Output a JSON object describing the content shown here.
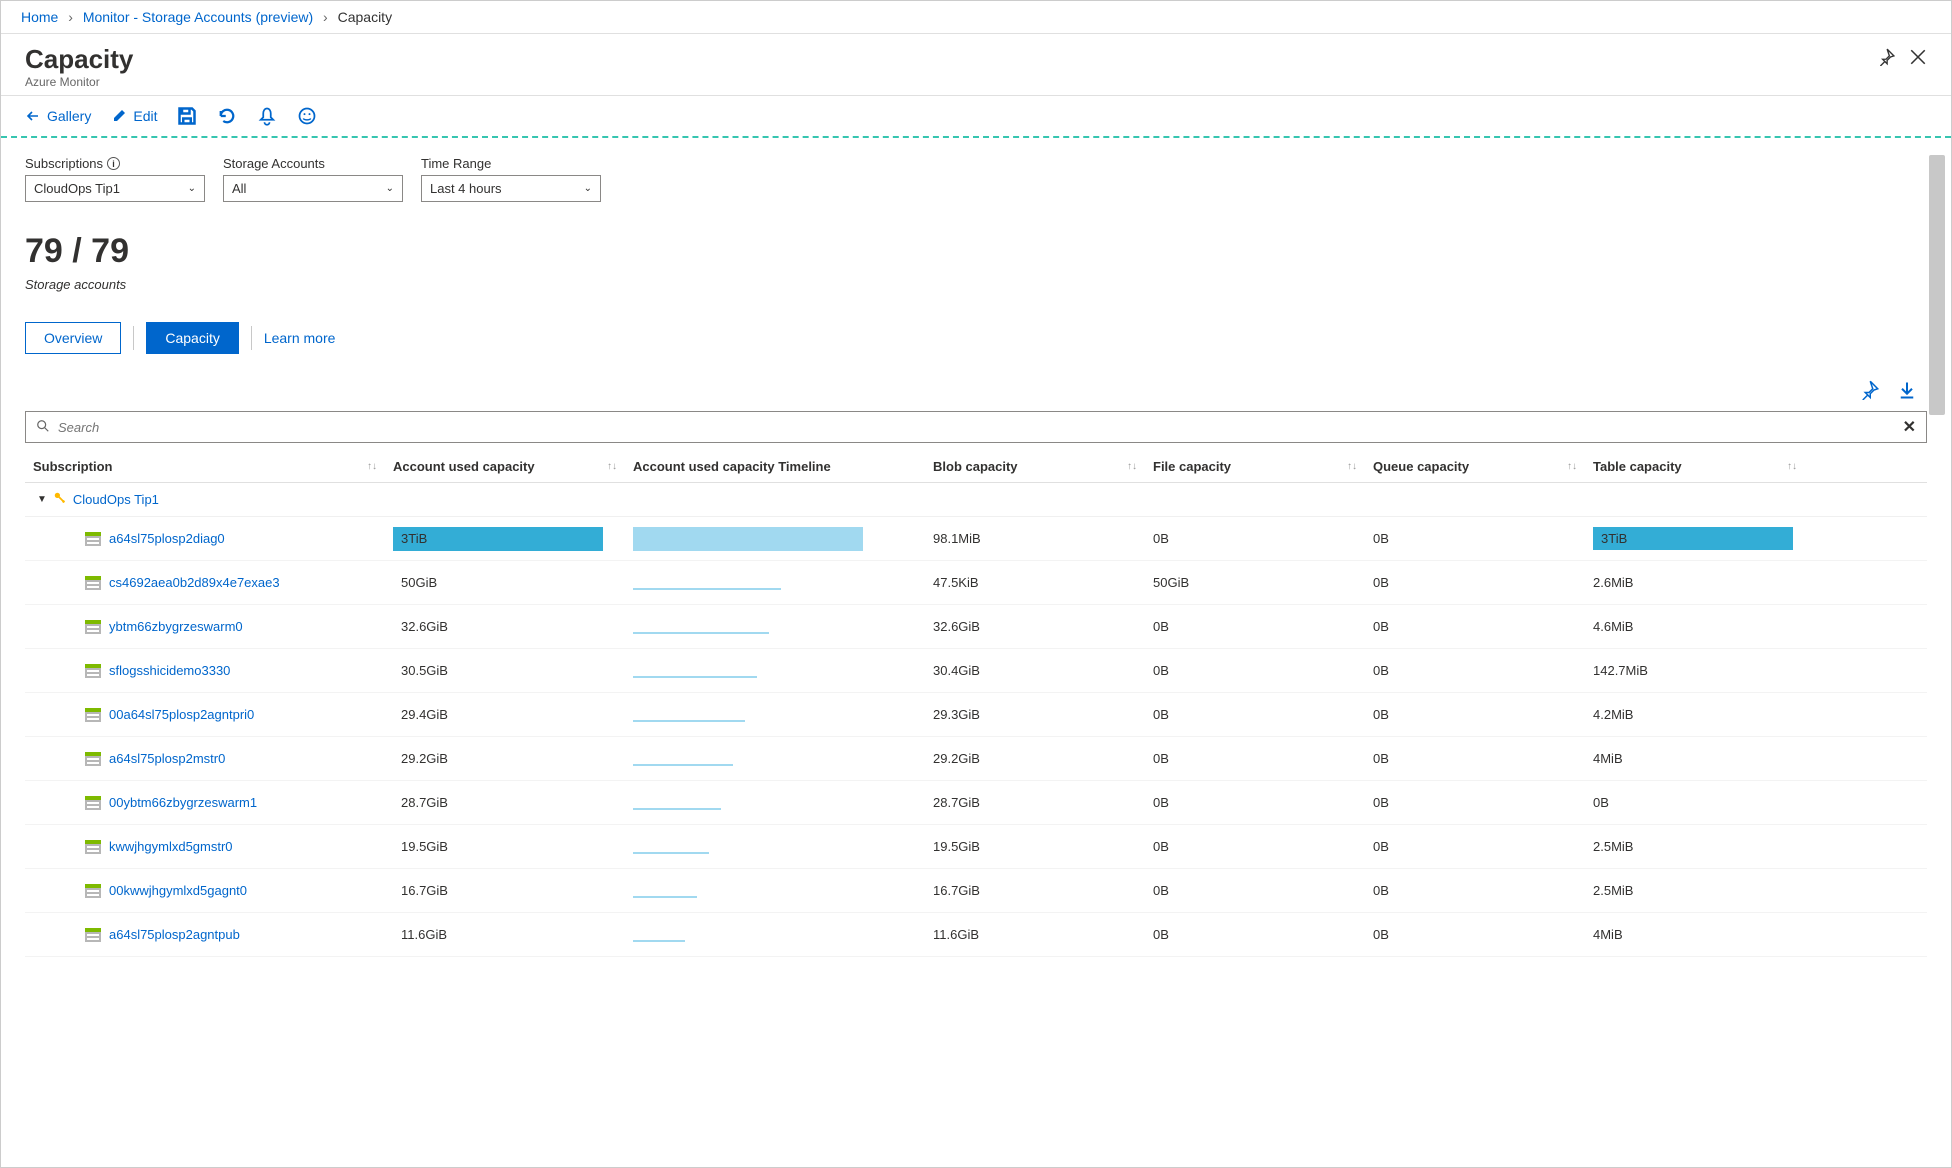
{
  "breadcrumb": {
    "home": "Home",
    "mid": "Monitor - Storage Accounts (preview)",
    "current": "Capacity"
  },
  "header": {
    "title": "Capacity",
    "subtitle": "Azure Monitor"
  },
  "toolbar": {
    "gallery": "Gallery",
    "edit": "Edit"
  },
  "filters": {
    "subscriptions": {
      "label": "Subscriptions",
      "value": "CloudOps Tip1"
    },
    "storage_accounts": {
      "label": "Storage Accounts",
      "value": "All"
    },
    "time_range": {
      "label": "Time Range",
      "value": "Last 4 hours"
    }
  },
  "count": {
    "value": "79 / 79",
    "label": "Storage accounts"
  },
  "tabs": {
    "overview": "Overview",
    "capacity": "Capacity",
    "learn": "Learn more"
  },
  "search": {
    "placeholder": "Search"
  },
  "columns": {
    "subscription": "Subscription",
    "auc": "Account used capacity",
    "timeline": "Account used capacity Timeline",
    "blob": "Blob capacity",
    "file": "File capacity",
    "queue": "Queue capacity",
    "table": "Table capacity"
  },
  "group": {
    "name": "CloudOps Tip1"
  },
  "rows": [
    {
      "name": "a64sl75plosp2diag0",
      "auc": "3TiB",
      "auc_pct": 100,
      "auc_color": "#33add6",
      "tl_color": "#a1d9f0",
      "blob": "98.1MiB",
      "file": "0B",
      "queue": "0B",
      "table": "3TiB",
      "table_hl": true
    },
    {
      "name": "cs4692aea0b2d89x4e7exae3",
      "auc": "50GiB",
      "auc_pct": 1,
      "auc_color": "transparent",
      "tl_color": "#a1d9f0",
      "blob": "47.5KiB",
      "file": "50GiB",
      "queue": "0B",
      "table": "2.6MiB",
      "table_hl": false
    },
    {
      "name": "ybtm66zbygrzeswarm0",
      "auc": "32.6GiB",
      "auc_pct": 1,
      "auc_color": "transparent",
      "tl_color": "#a1d9f0",
      "blob": "32.6GiB",
      "file": "0B",
      "queue": "0B",
      "table": "4.6MiB",
      "table_hl": false
    },
    {
      "name": "sflogsshicidemo3330",
      "auc": "30.5GiB",
      "auc_pct": 1,
      "auc_color": "transparent",
      "tl_color": "#a1d9f0",
      "blob": "30.4GiB",
      "file": "0B",
      "queue": "0B",
      "table": "142.7MiB",
      "table_hl": false
    },
    {
      "name": "00a64sl75plosp2agntpri0",
      "auc": "29.4GiB",
      "auc_pct": 1,
      "auc_color": "transparent",
      "tl_color": "#a1d9f0",
      "blob": "29.3GiB",
      "file": "0B",
      "queue": "0B",
      "table": "4.2MiB",
      "table_hl": false
    },
    {
      "name": "a64sl75plosp2mstr0",
      "auc": "29.2GiB",
      "auc_pct": 1,
      "auc_color": "transparent",
      "tl_color": "#a1d9f0",
      "blob": "29.2GiB",
      "file": "0B",
      "queue": "0B",
      "table": "4MiB",
      "table_hl": false
    },
    {
      "name": "00ybtm66zbygrzeswarm1",
      "auc": "28.7GiB",
      "auc_pct": 1,
      "auc_color": "transparent",
      "tl_color": "#a1d9f0",
      "blob": "28.7GiB",
      "file": "0B",
      "queue": "0B",
      "table": "0B",
      "table_hl": false
    },
    {
      "name": "kwwjhgymlxd5gmstr0",
      "auc": "19.5GiB",
      "auc_pct": 1,
      "auc_color": "transparent",
      "tl_color": "#a1d9f0",
      "blob": "19.5GiB",
      "file": "0B",
      "queue": "0B",
      "table": "2.5MiB",
      "table_hl": false
    },
    {
      "name": "00kwwjhgymlxd5gagnt0",
      "auc": "16.7GiB",
      "auc_pct": 1,
      "auc_color": "transparent",
      "tl_color": "#a1d9f0",
      "blob": "16.7GiB",
      "file": "0B",
      "queue": "0B",
      "table": "2.5MiB",
      "table_hl": false
    },
    {
      "name": "a64sl75plosp2agntpub",
      "auc": "11.6GiB",
      "auc_pct": 1,
      "auc_color": "transparent",
      "tl_color": "#a1d9f0",
      "blob": "11.6GiB",
      "file": "0B",
      "queue": "0B",
      "table": "4MiB",
      "table_hl": false
    }
  ]
}
